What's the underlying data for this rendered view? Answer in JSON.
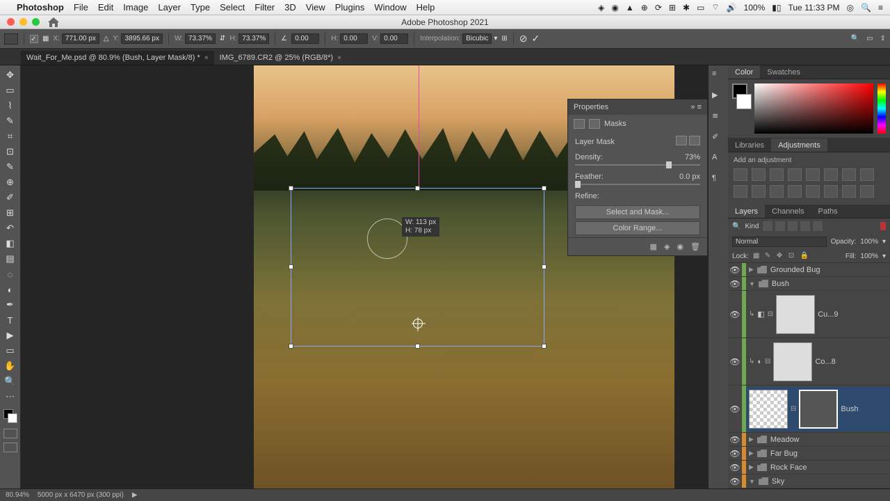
{
  "mac_menu": {
    "app": "Photoshop",
    "items": [
      "File",
      "Edit",
      "Image",
      "Layer",
      "Type",
      "Select",
      "Filter",
      "3D",
      "View",
      "Plugins",
      "Window",
      "Help"
    ],
    "battery": "100%",
    "clock": "Tue 11:33 PM"
  },
  "window_title": "Adobe Photoshop 2021",
  "options_bar": {
    "x_label": "X:",
    "x": "771.00 px",
    "y_label": "Y:",
    "y": "3895.66 px",
    "w_label": "W:",
    "w": "73.37%",
    "h_label": "H:",
    "h": "73.37%",
    "angle_label": "",
    "angle": "0.00",
    "h2_label": "H:",
    "h2": "0.00",
    "v_label": "V:",
    "v": "0.00",
    "interp_label": "Interpolation:",
    "interp_value": "Bicubic"
  },
  "tabs": [
    {
      "label": "Wait_For_Me.psd @ 80.9% (Bush, Layer Mask/8) *",
      "active": true
    },
    {
      "label": "IMG_6789.CR2 @ 25% (RGB/8*)",
      "active": false
    }
  ],
  "transform_hint": {
    "w": "W: 113 px",
    "h": "H: 78 px"
  },
  "properties": {
    "title": "Properties",
    "section": "Masks",
    "mask_title": "Layer Mask",
    "density_label": "Density:",
    "density_value": "73%",
    "feather_label": "Feather:",
    "feather_value": "0.0 px",
    "refine_label": "Refine:",
    "btn_select_mask": "Select and Mask...",
    "btn_color_range": "Color Range..."
  },
  "color_tab": "Color",
  "swatches_tab": "Swatches",
  "libraries_tab": "Libraries",
  "adjustments_tab": "Adjustments",
  "add_adjustment": "Add an adjustment",
  "layers_tab": "Layers",
  "channels_tab": "Channels",
  "paths_tab": "Paths",
  "layers": {
    "kind_placeholder": "Kind",
    "blend_mode": "Normal",
    "opacity_label": "Opacity:",
    "opacity": "100%",
    "lock_label": "Lock:",
    "fill_label": "Fill:",
    "fill": "100%",
    "items": {
      "grounded_bug": "Grounded Bug",
      "bush": "Bush",
      "cu9": "Cu...9",
      "co8": "Co...8",
      "bush2": "Bush",
      "meadow": "Meadow",
      "far_bug": "Far Bug",
      "rock_face": "Rock Face",
      "sky": "Sky"
    }
  },
  "status": {
    "zoom": "80.94%",
    "doc_info": "5000 px x 6470 px (300 ppi)"
  }
}
